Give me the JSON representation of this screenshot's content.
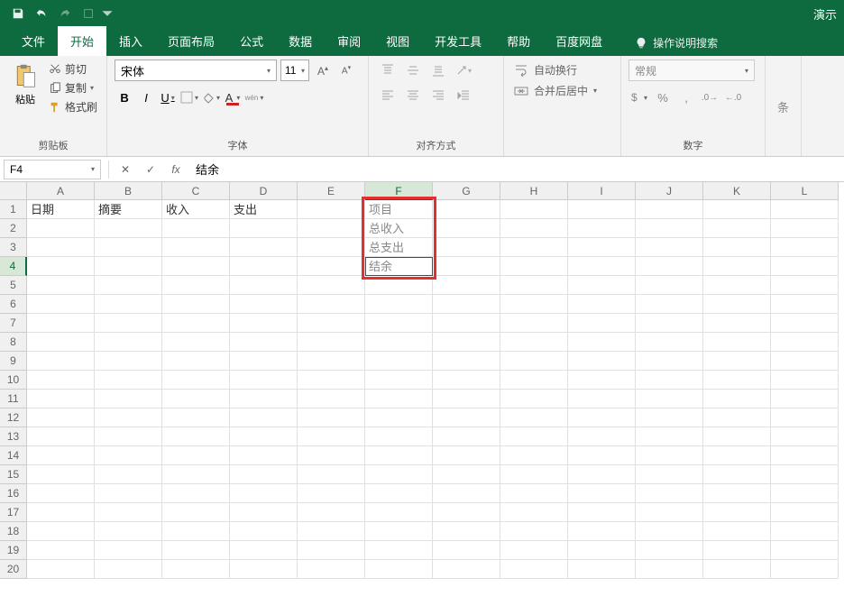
{
  "titlebar": {
    "right_text": "演示"
  },
  "tabs": {
    "file": "文件",
    "home": "开始",
    "insert": "插入",
    "layout": "页面布局",
    "formulas": "公式",
    "data": "数据",
    "review": "审阅",
    "view": "视图",
    "dev": "开发工具",
    "help": "帮助",
    "baidu": "百度网盘",
    "tellme": "操作说明搜索"
  },
  "ribbon": {
    "clipboard": {
      "paste": "粘贴",
      "cut": "剪切",
      "copy": "复制",
      "format_painter": "格式刷",
      "label": "剪贴板"
    },
    "font": {
      "name": "宋体",
      "size": "11",
      "label": "字体"
    },
    "align": {
      "wrap": "自动换行",
      "merge": "合并后居中",
      "label": "对齐方式"
    },
    "number": {
      "format": "常规",
      "label": "数字"
    },
    "cond": "条"
  },
  "formula_bar": {
    "cell_ref": "F4",
    "formula": "结余"
  },
  "grid": {
    "cols": [
      "A",
      "B",
      "C",
      "D",
      "E",
      "F",
      "G",
      "H",
      "I",
      "J",
      "K",
      "L"
    ],
    "rows": 20,
    "active_col": "F",
    "active_row": 4,
    "data": {
      "A1": "日期",
      "B1": "摘要",
      "C1": "收入",
      "D1": "支出",
      "F1": "项目",
      "F2": "总收入",
      "F3": "总支出",
      "F4": "结余"
    },
    "gray_cells": [
      "F1",
      "F2",
      "F3",
      "F4"
    ],
    "highlight_box": {
      "col_start": "F",
      "col_end": "F",
      "row_start": 1,
      "row_end": 4
    }
  }
}
